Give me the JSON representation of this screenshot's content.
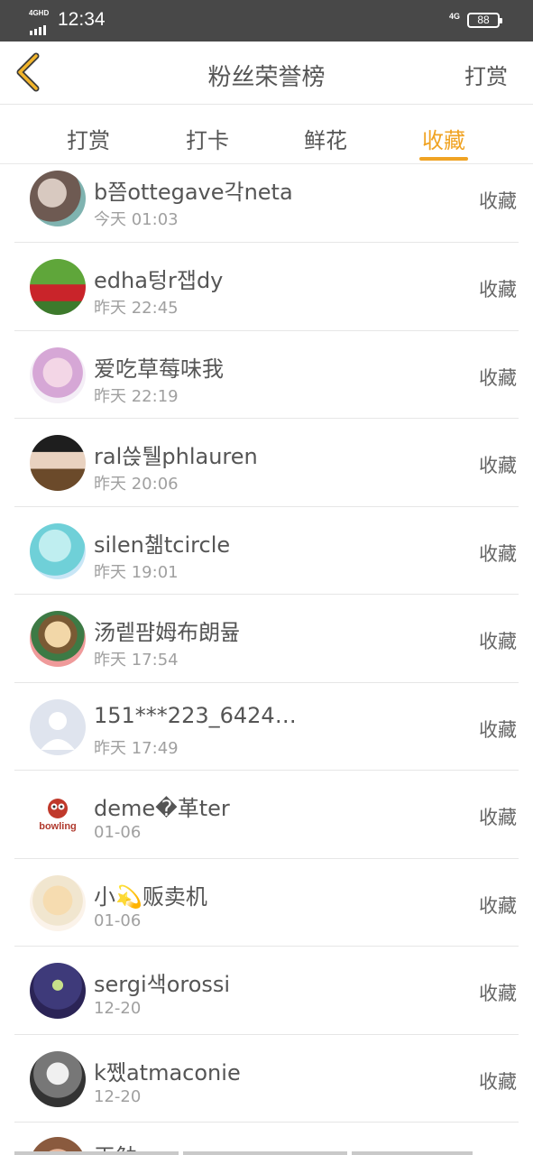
{
  "status_bar": {
    "network": "4GHD",
    "time": "12:34",
    "network_right": "4G",
    "battery": "88"
  },
  "header": {
    "back_icon": "chevron-left-icon",
    "title": "粉丝荣誉榜",
    "action": "打赏"
  },
  "tabs": [
    {
      "label": "打赏",
      "active": false
    },
    {
      "label": "打卡",
      "active": false
    },
    {
      "label": "鲜花",
      "active": false
    },
    {
      "label": "收藏",
      "active": true
    }
  ],
  "colors": {
    "accent": "#f0a323",
    "status_bar": "#484848",
    "text": "#555555",
    "subtext": "#a0a0a0"
  },
  "list": [
    {
      "name": "b쯤ottegave각neta",
      "time": "今天 01:03",
      "action": "收藏"
    },
    {
      "name": "edha텅r잽dy",
      "time": "昨天 22:45",
      "action": "收藏"
    },
    {
      "name": "爱吃草莓味我",
      "time": "昨天 22:19",
      "action": "收藏"
    },
    {
      "name": "ral쓵퉬phlauren",
      "time": "昨天 20:06",
      "action": "收藏"
    },
    {
      "name": "silen쳶tcircle",
      "time": "昨天 19:01",
      "action": "收藏"
    },
    {
      "name": "汤렡퍔姆布朗뮲",
      "time": "昨天 17:54",
      "action": "收藏"
    },
    {
      "name": "151***223_6424…",
      "time": "昨天 17:49",
      "action": "收藏"
    },
    {
      "name": "deme�革ter",
      "time": "01-06",
      "action": "收藏"
    },
    {
      "name": "小💫贩卖机",
      "time": "01-06",
      "action": "收藏"
    },
    {
      "name": "sergi색orossi",
      "time": "12-20",
      "action": "收藏"
    },
    {
      "name": "k쩼atmaconie",
      "time": "12-20",
      "action": "收藏"
    },
    {
      "name": "王勉",
      "time": "",
      "action": ""
    }
  ],
  "avatar_8_text": "bowling"
}
